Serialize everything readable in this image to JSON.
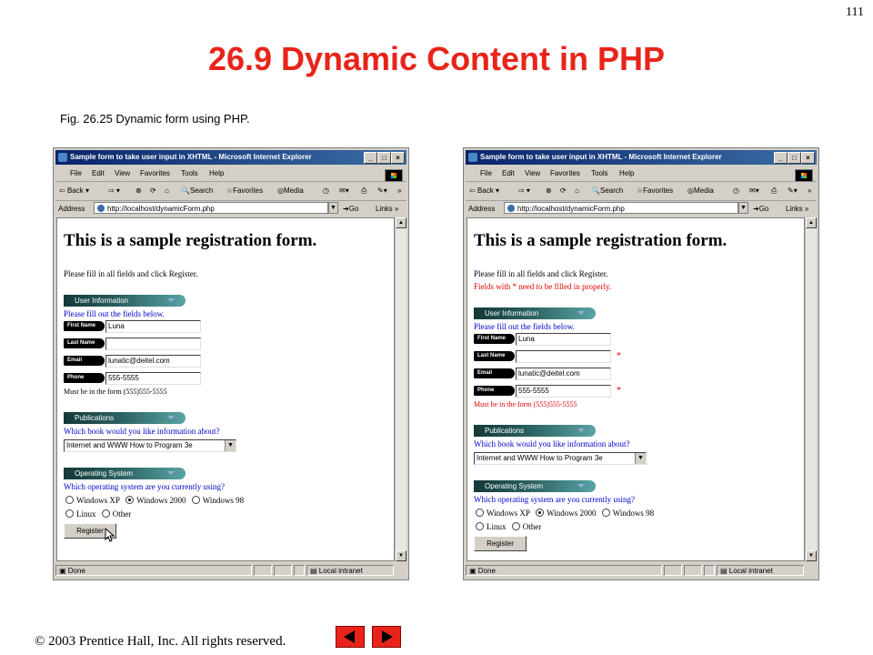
{
  "page_number": "111",
  "slide_title": "26.9 Dynamic Content in PHP",
  "caption": "Fig. 26.25    Dynamic form using PHP.",
  "copyright": "© 2003 Prentice Hall, Inc.  All rights reserved.",
  "browser": {
    "title": "Sample form to take user input in XHTML - Microsoft Internet Explorer",
    "menu": [
      "File",
      "Edit",
      "View",
      "Favorites",
      "Tools",
      "Help"
    ],
    "toolbar": {
      "back": "Back",
      "search": "Search",
      "favorites": "Favorites",
      "media": "Media"
    },
    "address_label": "Address",
    "address_value": "http://localhost/dynamicForm.php",
    "go_label": "Go",
    "links_label": "Links",
    "status_left": "Done",
    "status_right": "Local intranet"
  },
  "form": {
    "heading": "This is a sample registration form.",
    "instructions": "Please fill in all fields and click Register.",
    "error_message": "Fields with * need to be filled in properly.",
    "user_info_banner": "User Information",
    "fill_out": "Please fill out the fields below.",
    "first_name_label": "First Name",
    "last_name_label": "Last Name",
    "email_label": "Email",
    "phone_label": "Phone",
    "first_name_value": "Luna",
    "last_name_value": "",
    "email_value": "lunatic@deitel.com",
    "phone_value": "555-5555",
    "required_marker": "*",
    "phone_format": "Must be in the form (555)555-5555",
    "publications_banner": "Publications",
    "book_question": "Which book would you like information about?",
    "book_selected": "Internet and WWW How to Program 3e",
    "os_banner": "Operating System",
    "os_question": "Which operating system are you currently using?",
    "os_options": [
      "Windows XP",
      "Windows 2000",
      "Windows 98",
      "Linux",
      "Other"
    ],
    "os_selected": "Windows 2000",
    "register_label": "Register"
  },
  "icons": [
    "ie-page-icon",
    "minimize-icon",
    "maximize-icon",
    "close-icon",
    "windows-logo-icon",
    "back-arrow-icon",
    "forward-arrow-icon",
    "cursor-icon",
    "prev-slide-icon",
    "next-slide-icon"
  ],
  "colors": {
    "title_red": "#e8241a",
    "error_red": "#e00000",
    "form_blue": "#0000cc",
    "titlebar_blue": "#0a246a",
    "banner_teal": "#2a6060"
  }
}
